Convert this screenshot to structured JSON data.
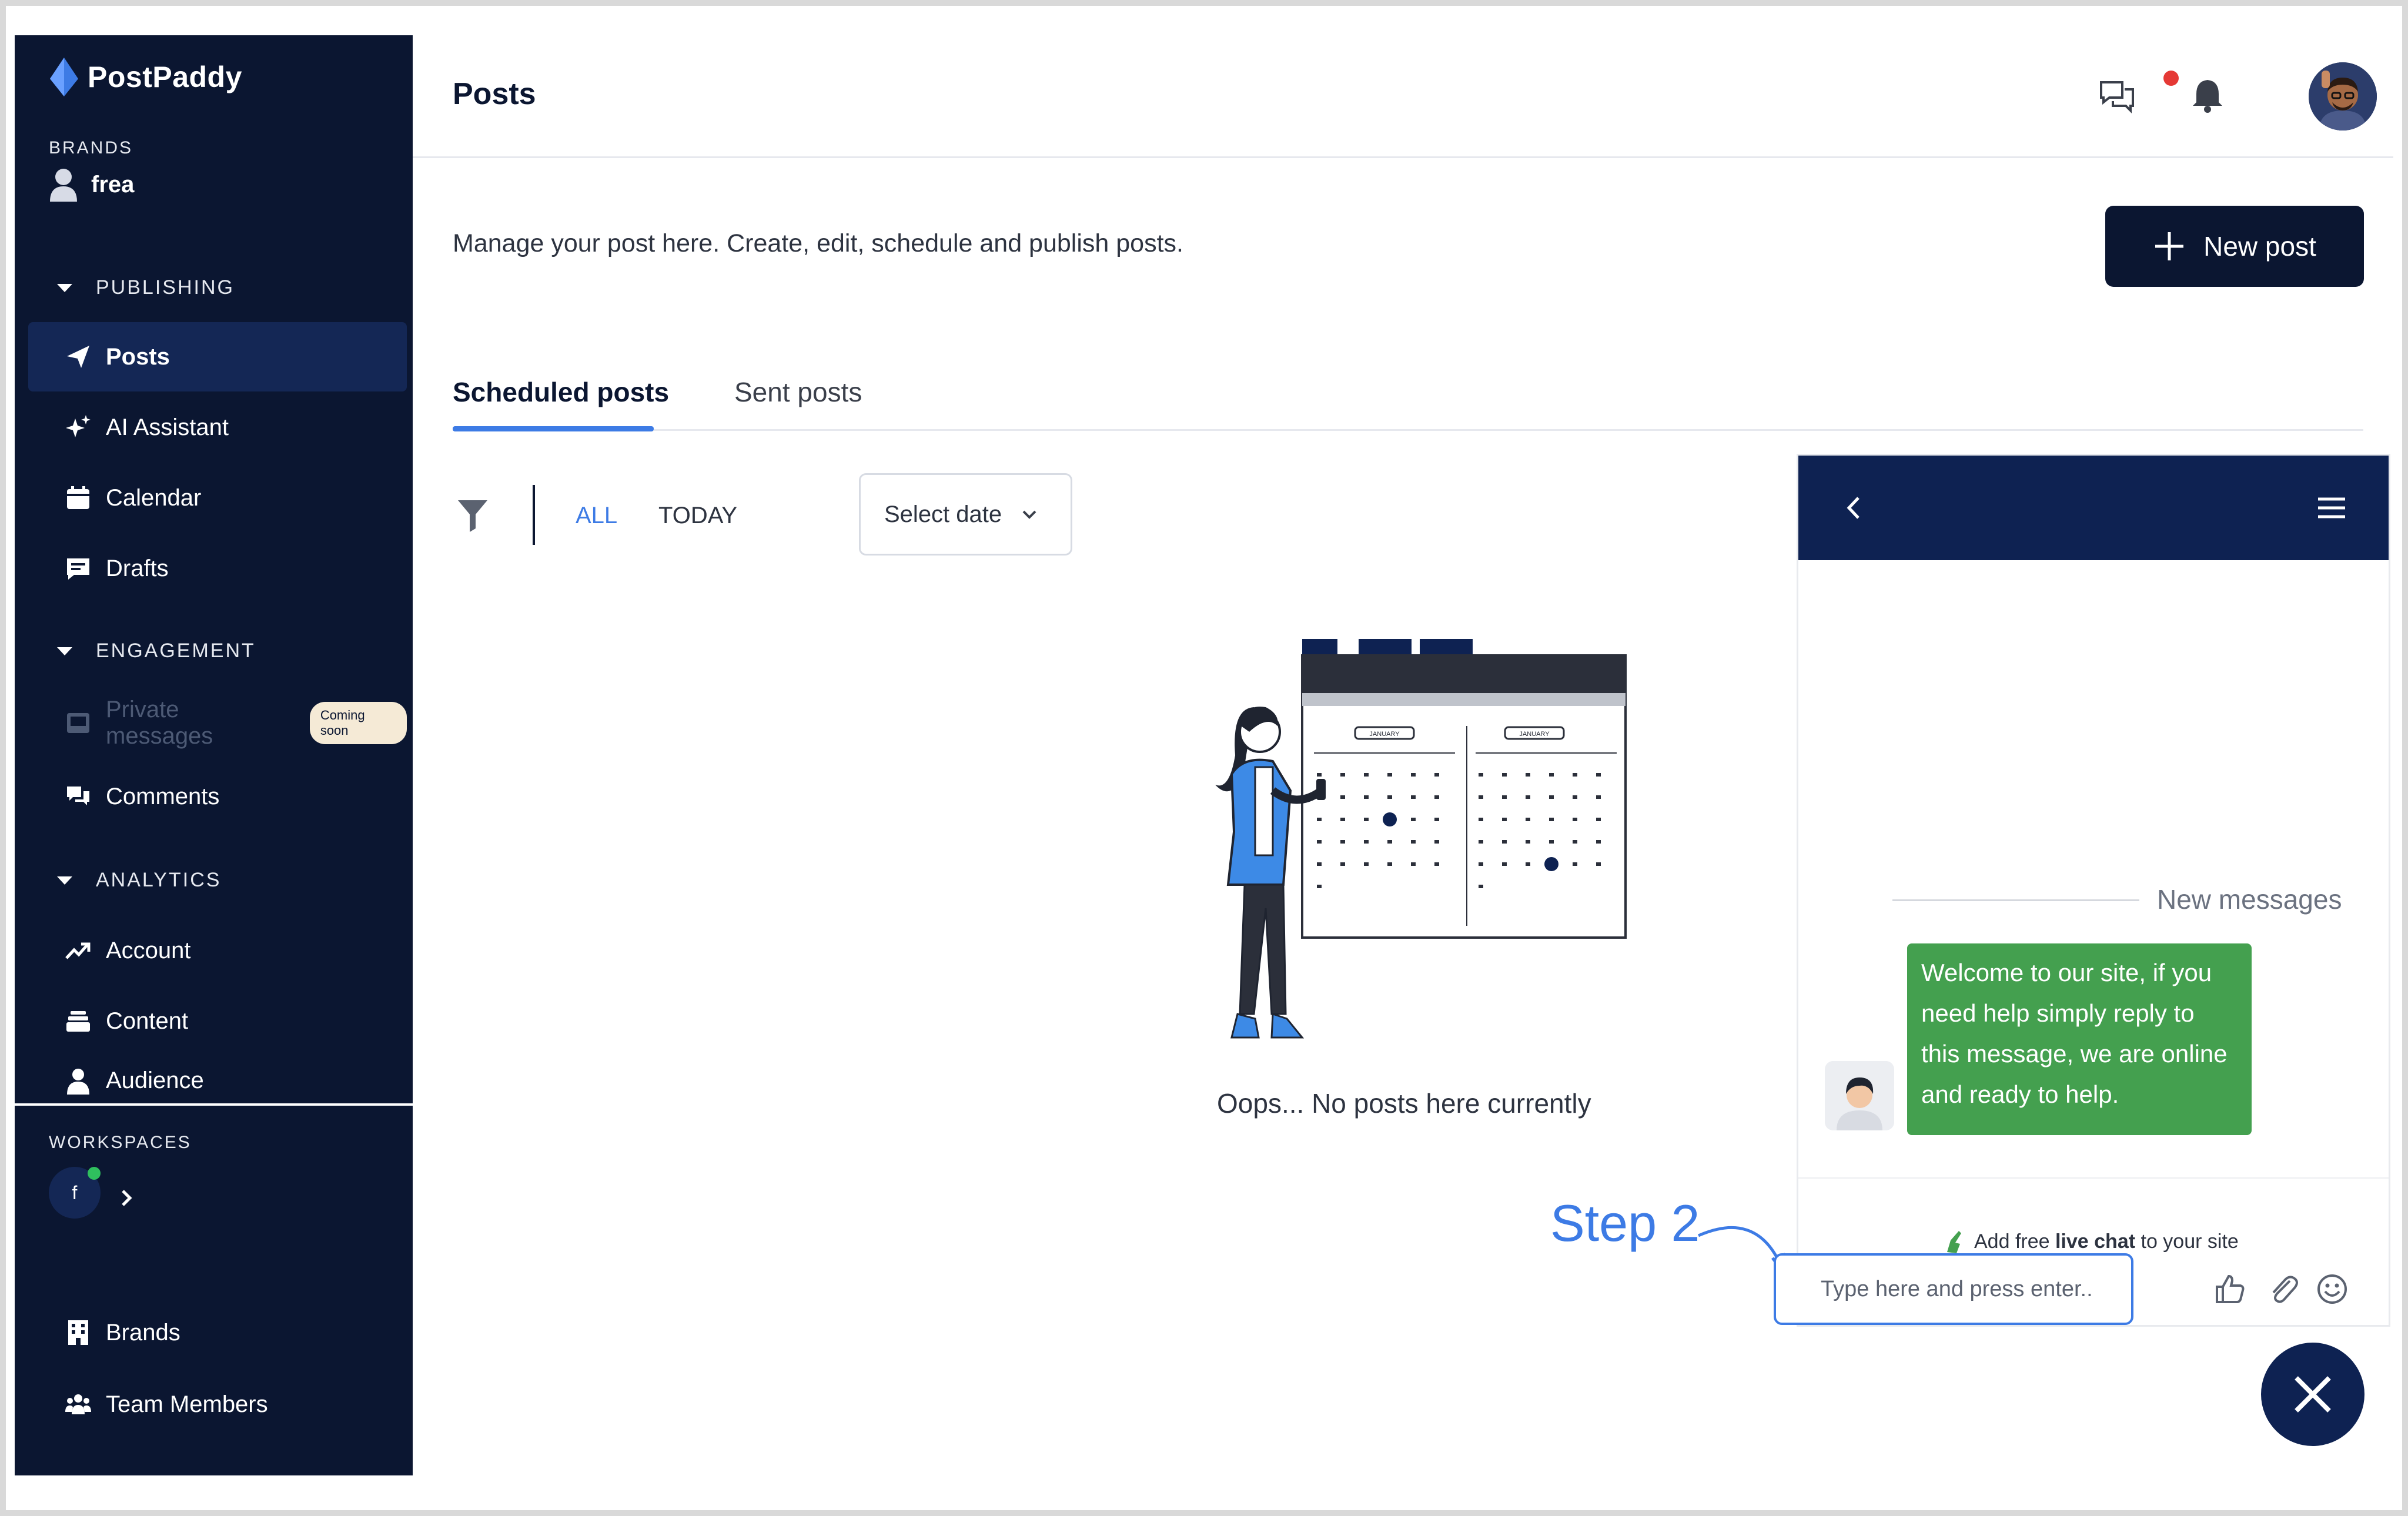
{
  "app": {
    "name": "PostPaddy"
  },
  "sidebar": {
    "brands_label": "BRANDS",
    "brand_name": "frea",
    "publishing_label": "PUBLISHING",
    "publishing_items": [
      {
        "label": "Posts",
        "icon": "send-icon",
        "active": true
      },
      {
        "label": "AI Assistant",
        "icon": "sparkles-icon"
      },
      {
        "label": "Calendar",
        "icon": "calendar-icon"
      },
      {
        "label": "Drafts",
        "icon": "drafts-icon"
      }
    ],
    "engagement_label": "ENGAGEMENT",
    "engagement_items": [
      {
        "label": "Private messages",
        "icon": "inbox-icon",
        "disabled": true,
        "badge": "Coming soon"
      },
      {
        "label": "Comments",
        "icon": "comments-icon"
      }
    ],
    "analytics_label": "ANALYTICS",
    "analytics_items": [
      {
        "label": "Account",
        "icon": "trending-up-icon"
      },
      {
        "label": "Content",
        "icon": "stack-icon"
      },
      {
        "label": "Audience",
        "icon": "person-icon"
      }
    ],
    "workspaces_label": "WORKSPACES",
    "workspace_initial": "f",
    "bottom_items": [
      {
        "label": "Brands",
        "icon": "building-icon"
      },
      {
        "label": "Team Members",
        "icon": "team-icon"
      }
    ]
  },
  "header": {
    "title": "Posts"
  },
  "main": {
    "description": "Manage your post here. Create, edit, schedule and publish posts.",
    "new_post_label": "New post",
    "tabs": [
      {
        "label": "Scheduled posts",
        "active": true
      },
      {
        "label": "Sent posts"
      }
    ],
    "filters": {
      "all": "ALL",
      "today": "TODAY",
      "date_placeholder": "Select date"
    },
    "empty_message": "Oops... No posts here currently",
    "calendar_month": "JANUARY"
  },
  "annotation": {
    "text": "Step 2"
  },
  "chat": {
    "new_messages_label": "New messages",
    "welcome_message": "Welcome to our site, if you need help simply reply to this message, we are online and ready to help.",
    "powered_prefix": "Add free ",
    "powered_bold": "live chat",
    "powered_suffix": " to your site",
    "input_placeholder": "Type here and press enter.."
  },
  "colors": {
    "sidebar_bg": "#0b1631",
    "accent": "#3d7be5",
    "chat_bubble": "#44a04f",
    "notification_dot": "#e53935"
  }
}
